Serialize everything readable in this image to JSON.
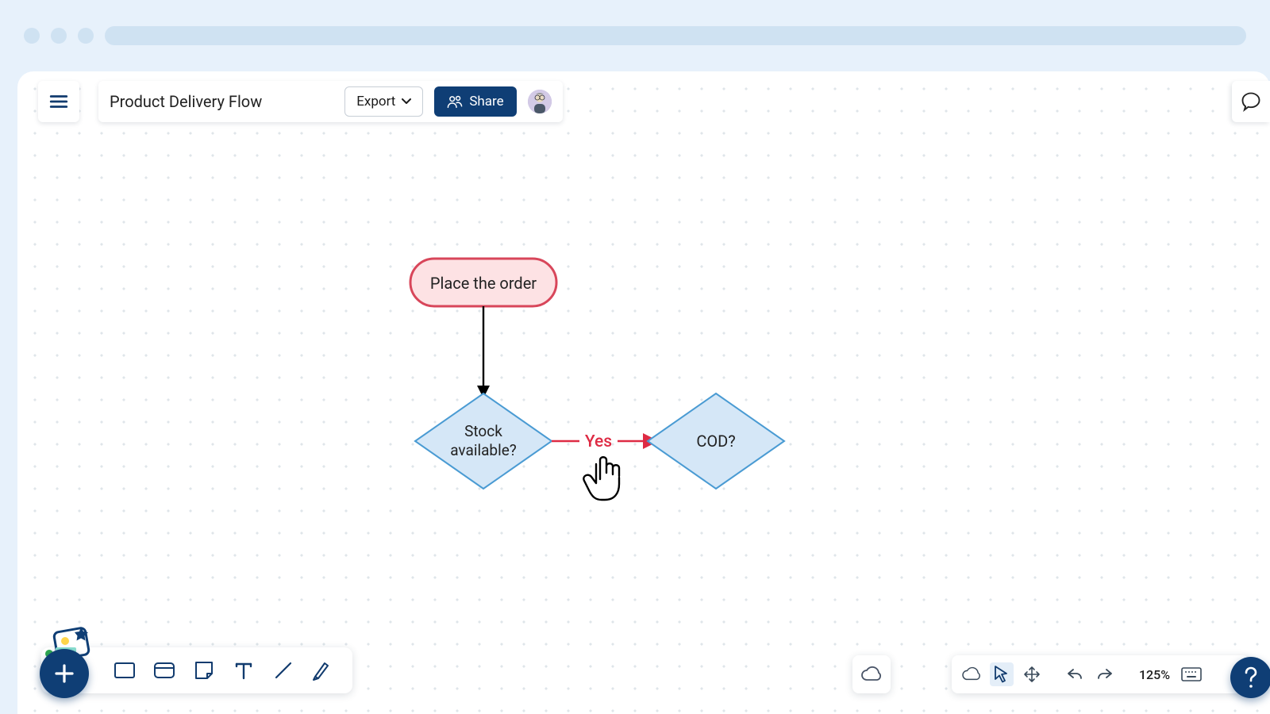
{
  "header": {
    "title": "Product Delivery Flow",
    "export_label": "Export",
    "share_label": "Share"
  },
  "flowchart": {
    "start": {
      "text": "Place the order"
    },
    "decision1": {
      "text_line1": "Stock",
      "text_line2": "available?"
    },
    "decision2": {
      "text": "COD?"
    },
    "edge_yes_label": "Yes"
  },
  "view": {
    "zoom_label": "125%"
  }
}
